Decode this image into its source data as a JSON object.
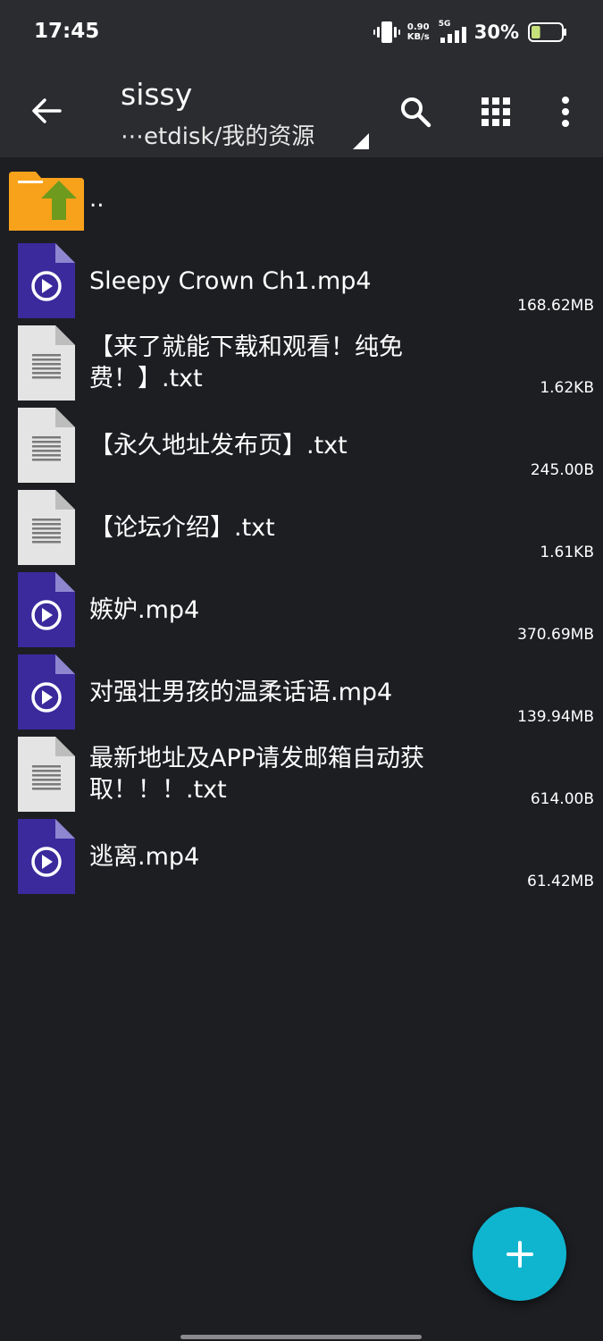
{
  "status_bar": {
    "time": "17:45",
    "net_speed_value": "0.90",
    "net_speed_unit": "KB/s",
    "network_type": "5G",
    "battery_percent": "30%",
    "battery_level": 0.3
  },
  "toolbar": {
    "title": "sissy",
    "path": "⋯etdisk/我的资源",
    "icons": {
      "back": "arrow-left-icon",
      "search": "search-icon",
      "grid": "grid-view-icon",
      "more": "more-vert-icon"
    }
  },
  "parent": {
    "label": ".."
  },
  "files": [
    {
      "name": "Sleepy Crown Ch1.mp4",
      "size": "168.62MB",
      "type": "video"
    },
    {
      "name": "【来了就能下载和观看！纯免费！】.txt",
      "size": "1.62KB",
      "type": "text"
    },
    {
      "name": "【永久地址发布页】.txt",
      "size": "245.00B",
      "type": "text"
    },
    {
      "name": "【论坛介绍】.txt",
      "size": "1.61KB",
      "type": "text"
    },
    {
      "name": "嫉妒.mp4",
      "size": "370.69MB",
      "type": "video"
    },
    {
      "name": "对强壮男孩的温柔话语.mp4",
      "size": "139.94MB",
      "type": "video"
    },
    {
      "name": "最新地址及APP请发邮箱自动获取！！！.txt",
      "size": "614.00B",
      "type": "text"
    },
    {
      "name": "逃离.mp4",
      "size": "61.42MB",
      "type": "video"
    }
  ],
  "fab": {
    "icon": "plus-icon"
  },
  "colors": {
    "background": "#1d1e22",
    "toolbar": "#2b2c30",
    "video_icon": "#3a2a9c",
    "text_icon": "#e4e4e4",
    "fab": "#0fb5cf",
    "folder": "#f8a21b",
    "folder_arrow": "#6e9a1e"
  }
}
